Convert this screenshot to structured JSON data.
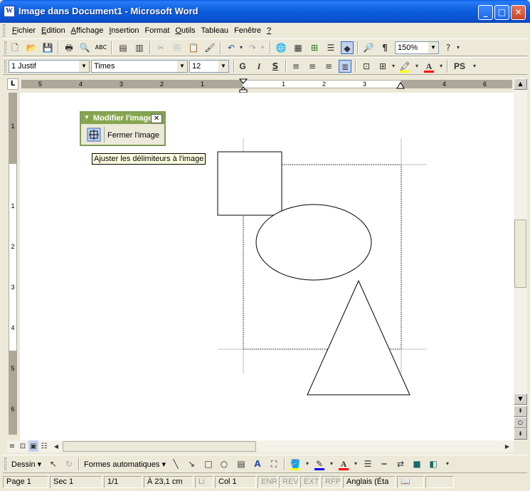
{
  "window": {
    "title": "Image dans Document1 - Microsoft Word",
    "app_icon_letter": "W",
    "minimize": "_",
    "maximize": "□",
    "close": "✕"
  },
  "menu": [
    {
      "label": "Fichier",
      "key": "F",
      "rest": "ichier"
    },
    {
      "label": "Edition",
      "key": "E",
      "rest": "dition"
    },
    {
      "label": "Affichage",
      "key": "A",
      "rest": "ffichage"
    },
    {
      "label": "Insertion",
      "key": "I",
      "rest": "nsertion"
    },
    {
      "label": "Format",
      "key": "",
      "rest": "Format"
    },
    {
      "label": "Outils",
      "key": "O",
      "rest": "utils"
    },
    {
      "label": "Tableau",
      "key": "",
      "rest": "Tableau"
    },
    {
      "label": "Fenêtre",
      "key": "",
      "rest": "Fenêtre"
    },
    {
      "label": "?",
      "key": "?",
      "rest": ""
    }
  ],
  "format_toolbar": {
    "style": "1 Justif",
    "font": "Times",
    "size": "12",
    "bold": "G",
    "italic": "I",
    "underline": "S",
    "ps": "PS"
  },
  "standard_toolbar": {
    "zoom": "150%"
  },
  "ruler": {
    "corner": "L",
    "h_labels": [
      "5",
      "4",
      "3",
      "2",
      "1",
      "1",
      "2",
      "3",
      "4",
      "5",
      "6"
    ],
    "v_labels": [
      "1",
      "1",
      "2",
      "3",
      "4",
      "5",
      "6"
    ]
  },
  "picture_toolbar": {
    "title": "Modifier l'image",
    "close_label": "Fermer l'image",
    "close_x": "✕"
  },
  "tooltip": "Ajuster les délimiteurs à l'image",
  "drawing_toolbar": {
    "draw": "Dessin",
    "autoshapes": "Formes automatiques"
  },
  "status": {
    "page": "Page  1",
    "sec": "Sec  1",
    "pages": "1/1",
    "position": "À  23,1 cm",
    "li": "Li",
    "col": "Col  1",
    "enr": "ENR",
    "rev": "REV",
    "ext": "EXT",
    "rfp": "RFP",
    "lang": "Anglais (Éta"
  },
  "colors": {
    "titlebar": "#0b52d0",
    "picture_toolbar_title": "#86a64e",
    "highlight_bar": "#ffff00",
    "font_color_bar": "#ff0000"
  }
}
